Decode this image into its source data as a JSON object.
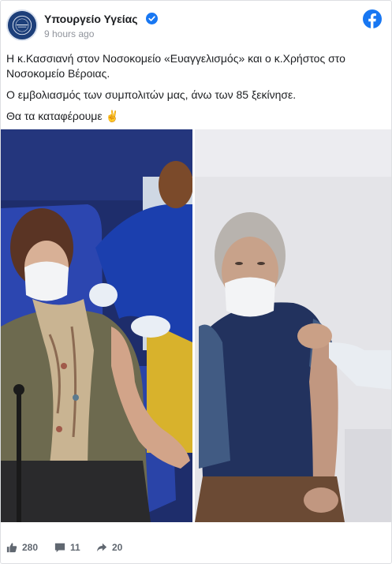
{
  "post": {
    "page_name": "Υπουργείο Υγείας",
    "verified": true,
    "timestamp": "9 hours ago",
    "avatar_icon": "ministry-logo-icon",
    "platform_icon": "facebook-icon",
    "text": {
      "line1": "Η κ.Κασσιανή στον Νοσοκομείο «Ευαγγελισμός» και ο κ.Χρήστος στο Νοσοκομείο Βέροιας.",
      "line2": "Ο εμβολιασμός των συμπολιτών μας, άνω των 85 ξεκίνησε.",
      "line3": "Θα τα καταφέρουμε",
      "line3_emoji": "✌️"
    }
  },
  "photos": [
    {
      "icon": "vaccination-photo-woman"
    },
    {
      "icon": "vaccination-photo-man"
    }
  ],
  "footer": {
    "likes": "280",
    "comments": "11",
    "shares": "20",
    "like_icon": "thumbs-up-icon",
    "comment_icon": "comment-icon",
    "share_icon": "share-icon"
  },
  "colors": {
    "brand": "#1877f2",
    "text": "#1c1e21",
    "muted": "#90949c",
    "border": "#dddfe2"
  }
}
